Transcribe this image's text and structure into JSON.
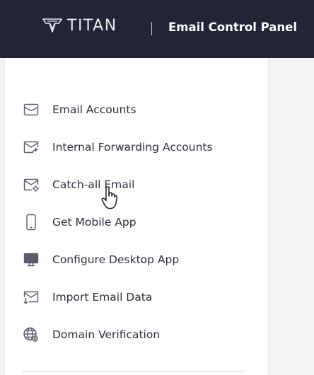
{
  "header": {
    "brand_name": "TITAN",
    "panel_title": "Email Control Panel"
  },
  "sidebar": {
    "items": [
      {
        "label": "Email Accounts",
        "icon": "envelope-icon"
      },
      {
        "label": "Internal Forwarding Accounts",
        "icon": "forward-envelope-icon"
      },
      {
        "label": "Catch-all Email",
        "icon": "catch-all-envelope-gear-icon"
      },
      {
        "label": "Get Mobile App",
        "icon": "mobile-phone-icon"
      },
      {
        "label": "Configure Desktop App",
        "icon": "desktop-monitor-icon"
      },
      {
        "label": "Import Email Data",
        "icon": "import-envelope-icon"
      },
      {
        "label": "Domain Verification",
        "icon": "globe-gear-icon"
      }
    ]
  },
  "colors": {
    "topbar": "#222538",
    "icon": "#5a5d6c",
    "text": "#2c2f3a"
  }
}
